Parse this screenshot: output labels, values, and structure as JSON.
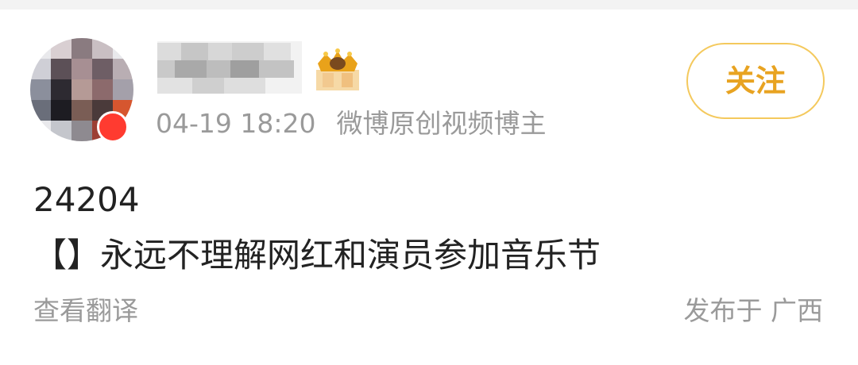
{
  "post": {
    "timestamp": "04-19 18:20",
    "author_role": "微博原创视频博主",
    "content_line1": "24204",
    "content_line2": "【】永远不理解网红和演员参加音乐节",
    "translate_label": "查看翻译",
    "location": "发布于 广西"
  },
  "actions": {
    "follow_label": "关注"
  },
  "colors": {
    "accent": "#e8a321",
    "accent_border": "#f4c95d",
    "meta_text": "#9a9a9a",
    "body_text": "#222222",
    "badge": "#ff3b30"
  },
  "icons": {
    "badge": "crown-icon",
    "avatar_badge": "verified-badge-icon"
  }
}
